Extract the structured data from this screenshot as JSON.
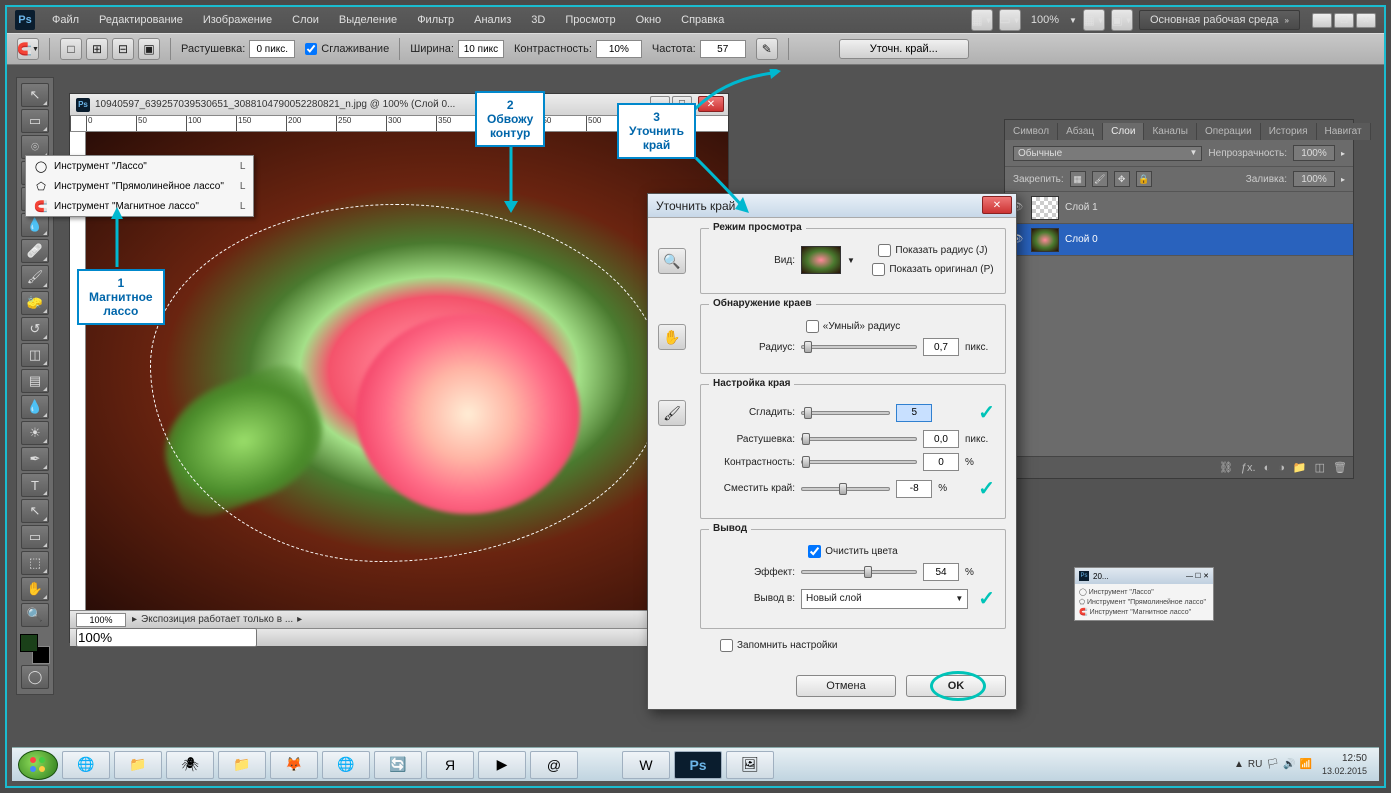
{
  "menu": {
    "items": [
      "Файл",
      "Редактирование",
      "Изображение",
      "Слои",
      "Выделение",
      "Фильтр",
      "Анализ",
      "3D",
      "Просмотр",
      "Окно",
      "Справка"
    ],
    "zoom": "100%",
    "workspace": "Основная рабочая среда"
  },
  "options": {
    "feather_label": "Растушевка:",
    "feather_val": "0 пикс.",
    "antialias": "Сглаживание",
    "width_label": "Ширина:",
    "width_val": "10 пикс",
    "contrast_label": "Контрастность:",
    "contrast_val": "10%",
    "freq_label": "Частота:",
    "freq_val": "57",
    "refine_btn": "Уточн. край..."
  },
  "lasso_flyout": {
    "items": [
      {
        "label": "Инструмент \"Лассо\"",
        "key": "L"
      },
      {
        "label": "Инструмент \"Прямолинейное лассо\"",
        "key": "L"
      },
      {
        "label": "Инструмент \"Магнитное лассо\"",
        "key": "L"
      }
    ]
  },
  "annotations": {
    "a1": {
      "num": "1",
      "text": "Магнитное\nлассо"
    },
    "a2": {
      "num": "2",
      "text": "Обвожу\nконтур"
    },
    "a3": {
      "num": "3",
      "text": "Уточнить\nкрай"
    }
  },
  "document": {
    "title": "10940597_639257039530651_3088104790052280821_n.jpg @ 100% (Слой 0...",
    "status_text": "Экспозиция работает только в ...",
    "zoom": "100%"
  },
  "refine": {
    "title": "Уточнить край",
    "g_view": "Режим просмотра",
    "view_label": "Вид:",
    "show_radius": "Показать радиус (J)",
    "show_orig": "Показать оригинал (P)",
    "g_edge": "Обнаружение краев",
    "smart_radius": "«Умный» радиус",
    "radius_label": "Радиус:",
    "radius_val": "0,7",
    "radius_unit": "пикс.",
    "g_adjust": "Настройка края",
    "smooth_label": "Сгладить:",
    "smooth_val": "5",
    "feather_label": "Растушевка:",
    "feather_val": "0,0",
    "feather_unit": "пикс.",
    "contrast_label": "Контрастность:",
    "contrast_val": "0",
    "contrast_unit": "%",
    "shift_label": "Сместить край:",
    "shift_val": "-8",
    "shift_unit": "%",
    "g_output": "Вывод",
    "decon": "Очистить цвета",
    "amount_label": "Эффект:",
    "amount_val": "54",
    "amount_unit": "%",
    "output_label": "Вывод в:",
    "output_val": "Новый слой",
    "remember": "Запомнить настройки",
    "cancel": "Отмена",
    "ok": "OK"
  },
  "layers_panel": {
    "tabs": [
      "Символ",
      "Абзац",
      "Слои",
      "Каналы",
      "Операции",
      "История",
      "Навигат"
    ],
    "active_tab": 2,
    "blend": "Обычные",
    "opacity_label": "Непрозрачность:",
    "opacity": "100%",
    "lock_label": "Закрепить:",
    "fill_label": "Заливка:",
    "fill": "100%",
    "layers": [
      {
        "name": "Слой 1"
      },
      {
        "name": "Слой 0"
      }
    ]
  },
  "mini": {
    "title": "20..."
  },
  "taskbar": {
    "lang": "RU",
    "time": "12:50",
    "date": "13.02.2015"
  }
}
